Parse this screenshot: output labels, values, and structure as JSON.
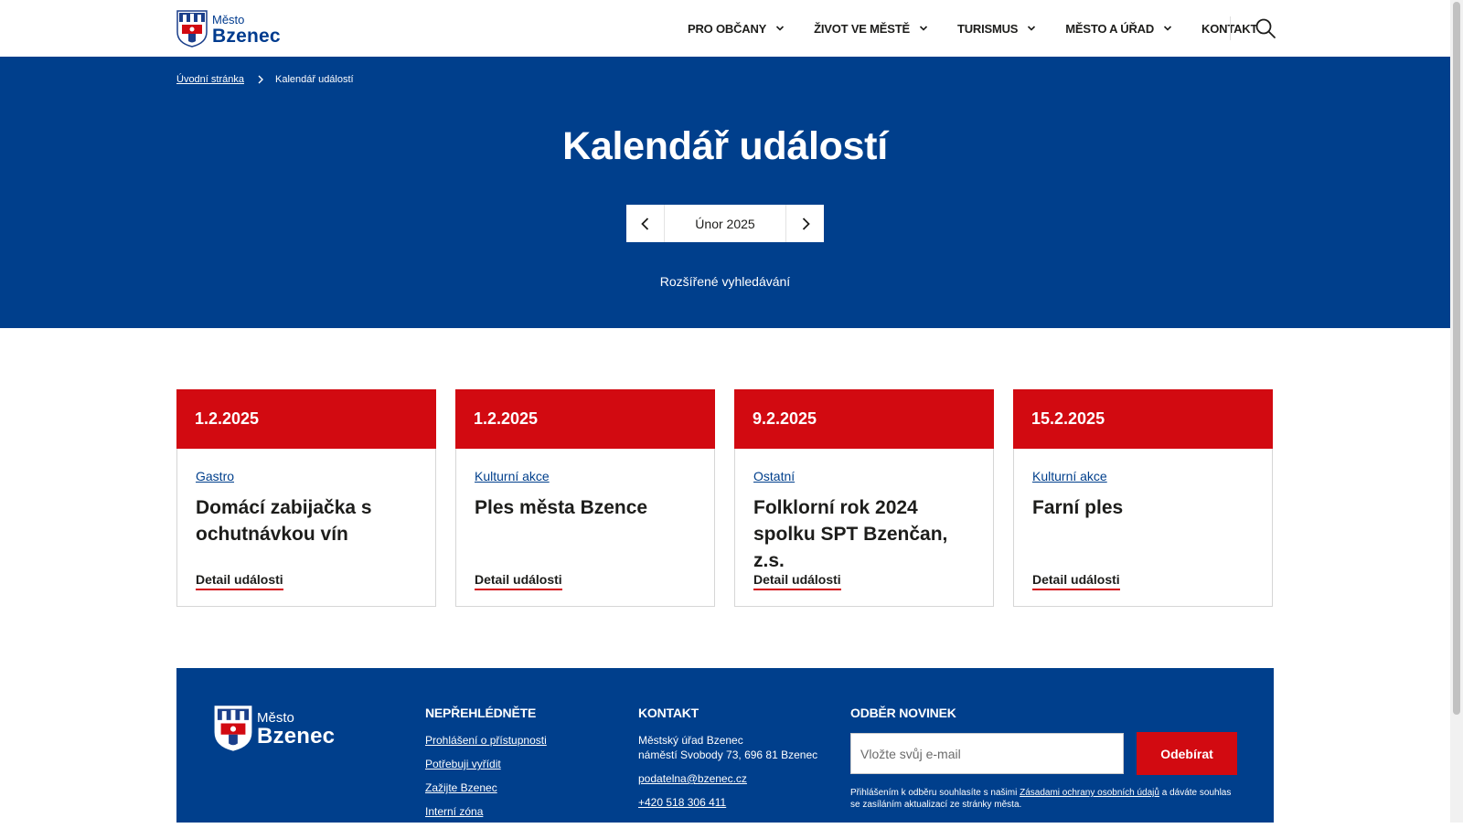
{
  "header": {
    "logo_small": "Město",
    "logo_big": "Bzenec",
    "nav": [
      {
        "label": "PRO OBČANY",
        "has_dropdown": true
      },
      {
        "label": "ŽIVOT VE MĚSTĚ",
        "has_dropdown": true
      },
      {
        "label": "TURISMUS",
        "has_dropdown": true
      },
      {
        "label": "MĚSTO A ÚŘAD",
        "has_dropdown": true
      },
      {
        "label": "KONTAKT",
        "has_dropdown": false
      }
    ],
    "search_icon": "search-icon"
  },
  "breadcrumb": {
    "home": "Úvodní stránka",
    "current": "Kalendář událostí"
  },
  "hero": {
    "title": "Kalendář událostí",
    "month": "Únor 2025",
    "advanced_search": "Rozšířené vyhledávání"
  },
  "events": [
    {
      "date": "1.2.2025",
      "category": "Gastro",
      "title": "Domácí zabijačka s ochutnávkou vín",
      "detail": "Detail události"
    },
    {
      "date": "1.2.2025",
      "category": "Kulturní akce",
      "title": "Ples města Bzence",
      "detail": "Detail události"
    },
    {
      "date": "9.2.2025",
      "category": "Ostatní",
      "title": "Folklorní rok 2024 spolku SPT Bzenčan, z.s.",
      "detail": "Detail události"
    },
    {
      "date": "15.2.2025",
      "category": "Kulturní akce",
      "title": "Farní ples",
      "detail": "Detail události"
    }
  ],
  "footer": {
    "logo_small": "Město",
    "logo_big": "Bzenec",
    "col1": {
      "heading": "NEPŘEHLÉDNĚTE",
      "links": [
        "Prohlášení o přístupnosti",
        "Potřebuji vyřídit",
        "Zažijte Bzenec",
        "Interní zóna"
      ]
    },
    "col2": {
      "heading": "KONTAKT",
      "line1": "Městský úřad Bzenec",
      "line2": "náměstí Svobody 73, 696 81 Bzenec",
      "email": "podatelna@bzenec.cz",
      "phone": "+420 518 306 411"
    },
    "col3": {
      "heading": "ODBĚR NOVINEK",
      "placeholder": "Vložte svůj e-mail",
      "button": "Odebírat",
      "note_before": "Přihlášením k odběru souhlasíte s našimi ",
      "note_link": "Zásadami ochrany osobních údajů",
      "note_after": " a dáváte souhlas se zasíláním aktualizací ze stránky města."
    }
  },
  "colors": {
    "brand_blue": "#003f8c",
    "accent_red": "#d20a11"
  }
}
